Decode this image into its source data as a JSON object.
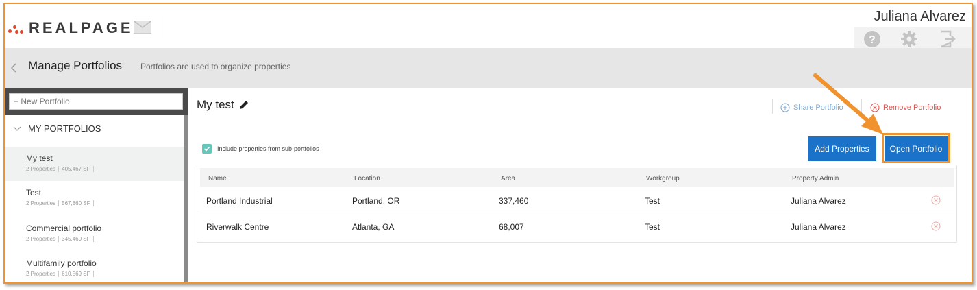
{
  "header": {
    "logo_text": "REALPAGE",
    "user_name": "Juliana Alvarez",
    "icons": [
      "mail-icon",
      "help-icon",
      "gear-icon",
      "logout-icon"
    ]
  },
  "titlebar": {
    "title": "Manage Portfolios",
    "subtitle": "Portfolios are used to organize properties"
  },
  "sidebar": {
    "new_portfolio_placeholder": "+ New Portfolio",
    "section_label": "MY PORTFOLIOS",
    "portfolios": [
      {
        "name": "My test",
        "properties": "2 Properties",
        "sf": "405,467 SF"
      },
      {
        "name": "Test",
        "properties": "2 Properties",
        "sf": "567,860 SF"
      },
      {
        "name": "Commercial portfolio",
        "properties": "2 Properties",
        "sf": "345,460 SF"
      },
      {
        "name": "Multifamily portfolio",
        "properties": "2 Properties",
        "sf": "610,569 SF"
      }
    ]
  },
  "main": {
    "portfolio_title": "My test",
    "share_label": "Share Portfolio",
    "remove_label": "Remove Portfolio",
    "include_label": "Include properties from sub-portfolios",
    "add_properties_label": "Add Properties",
    "open_portfolio_label": "Open Portfolio",
    "columns": [
      "Name",
      "Location",
      "Area",
      "Workgroup",
      "Property Admin"
    ],
    "rows": [
      {
        "name": "Portland Industrial",
        "location": "Portland, OR",
        "area": "337,460",
        "workgroup": "Test",
        "admin": "Juliana Alvarez"
      },
      {
        "name": "Riverwalk Centre",
        "location": "Atlanta, GA",
        "area": "68,007",
        "workgroup": "Test",
        "admin": "Juliana Alvarez"
      }
    ]
  },
  "colors": {
    "accent_blue": "#1a73c9",
    "annotation_orange": "#f0932f",
    "remove_red": "#d9534f",
    "checkbox_teal": "#66c6b9"
  }
}
